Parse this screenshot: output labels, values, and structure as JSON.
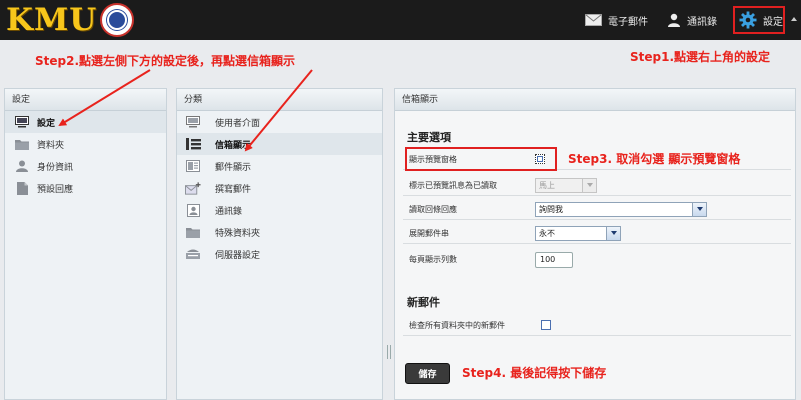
{
  "logo": {
    "text": "KMU"
  },
  "header": {
    "mail_label": "電子郵件",
    "contacts_label": "通訊錄",
    "settings_label": "設定"
  },
  "steps": {
    "step1": "Step1.點選右上角的設定",
    "step2": "Step2.點選左側下方的設定後，再點選信箱顯示",
    "step3": "Step3. 取消勾選 顯示預覽窗格",
    "step4": "Step4. 最後記得按下儲存"
  },
  "left_panel": {
    "title": "設定",
    "items": [
      {
        "label": "設定",
        "icon": "monitor-icon",
        "active": true
      },
      {
        "label": "資料夾",
        "icon": "folder-icon"
      },
      {
        "label": "身份資訊",
        "icon": "person-icon"
      },
      {
        "label": "預設回應",
        "icon": "document-icon"
      }
    ]
  },
  "middle_panel": {
    "title": "分類",
    "items": [
      {
        "label": "使用者介面",
        "icon": "monitor-icon"
      },
      {
        "label": "信箱顯示",
        "icon": "mailbox-list-icon",
        "active": true
      },
      {
        "label": "郵件顯示",
        "icon": "message-view-icon"
      },
      {
        "label": "撰寫郵件",
        "icon": "compose-mail-icon"
      },
      {
        "label": "通訊錄",
        "icon": "address-book-icon"
      },
      {
        "label": "特殊資料夾",
        "icon": "folder-icon"
      },
      {
        "label": "伺服器設定",
        "icon": "server-icon"
      }
    ]
  },
  "right_panel": {
    "title": "信箱顯示",
    "main_section": {
      "title": "主要選項",
      "rows": [
        {
          "label": "顯示預覽窗格",
          "type": "checkbox",
          "checked": false
        },
        {
          "label": "標示已預覽訊息為已讀取",
          "type": "select",
          "value": "馬上",
          "disabled": true
        },
        {
          "label": "讀取回條回應",
          "type": "select",
          "value": "詢問我"
        },
        {
          "label": "展開郵件串",
          "type": "select",
          "value": "永不"
        },
        {
          "label": "每頁顯示列數",
          "type": "text",
          "value": "100"
        }
      ]
    },
    "new_mail_section": {
      "title": "新郵件",
      "rows": [
        {
          "label": "檢查所有資料夾中的新郵件",
          "type": "checkbox",
          "checked": false
        }
      ]
    },
    "save_label": "儲存"
  },
  "colors": {
    "accent_red": "#e8231d",
    "header_bg": "#1b1b1b",
    "settings_blue": "#3aa0e0"
  }
}
